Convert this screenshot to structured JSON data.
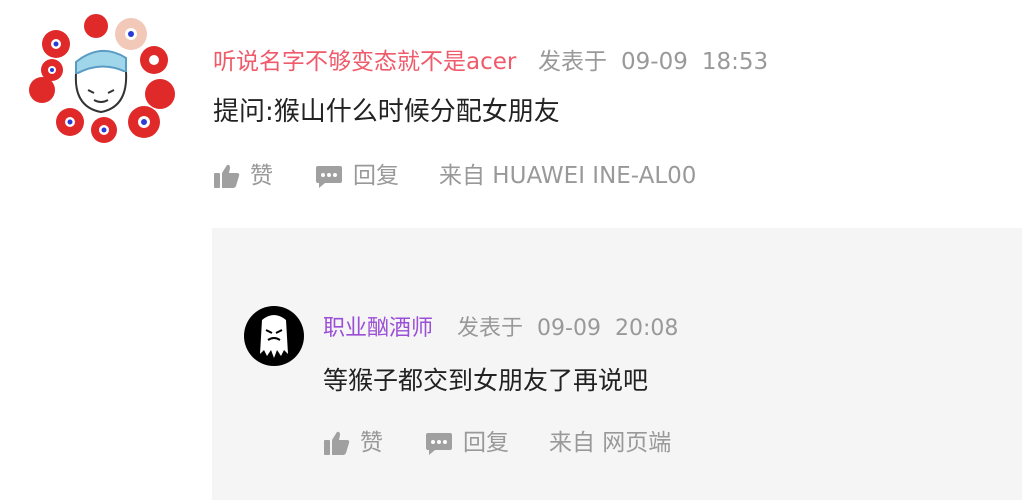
{
  "post": {
    "username": "听说名字不够变态就不是acer",
    "posted_label": "发表于",
    "date": "09-09",
    "time": "18:53",
    "content": "提问:猴山什么时候分配女朋友",
    "like_label": "赞",
    "reply_label": "回复",
    "source_label": "来自 HUAWEI  INE-AL00",
    "avatar_icon": "cartoon-avatar-icon",
    "name_color": "#ef5b6b"
  },
  "reply": {
    "username": "职业酗酒师",
    "posted_label": "发表于",
    "date": "09-09",
    "time": "20:08",
    "content": "等猴子都交到女朋友了再说吧",
    "like_label": "赞",
    "reply_label": "回复",
    "source_label": "来自 网页端",
    "avatar_icon": "ghost-avatar-icon",
    "name_color": "#9b4fd6"
  }
}
